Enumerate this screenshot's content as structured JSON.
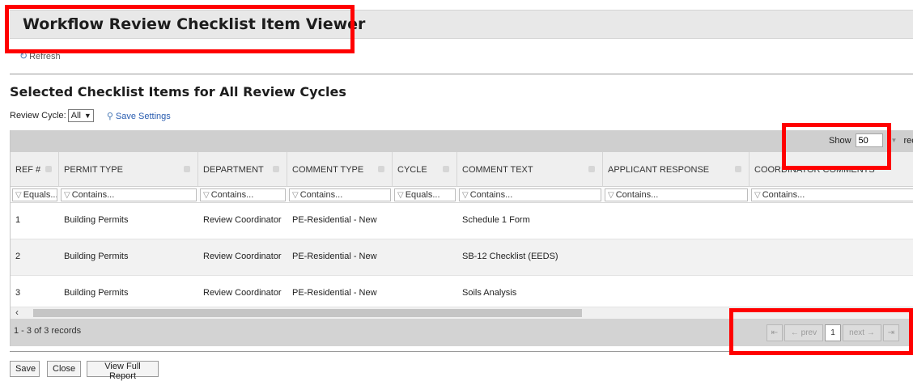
{
  "window": {
    "title": "Workflow Review Checklist Item Viewer"
  },
  "toolbar": {
    "refresh_label": "Refresh"
  },
  "section": {
    "title": "Selected Checklist Items for All Review Cycles"
  },
  "review_cycle": {
    "label": "Review Cycle:",
    "selected": "All",
    "save_settings_label": "Save Settings"
  },
  "grid": {
    "show_label": "Show",
    "page_size": "50",
    "records_label": "records",
    "columns": [
      "REF #",
      "PERMIT TYPE",
      "DEPARTMENT",
      "COMMENT TYPE",
      "CYCLE",
      "COMMENT TEXT",
      "APPLICANT RESPONSE",
      "COORDINATOR COMMENTS"
    ],
    "filters": [
      "Equals...",
      "Contains...",
      "Contains...",
      "Contains...",
      "Equals...",
      "Contains...",
      "Contains...",
      "Contains..."
    ],
    "rows": [
      {
        "ref": "1",
        "permit_type": "Building Permits",
        "department": "Review Coordinator",
        "comment_type": "PE-Residential - New",
        "cycle": "",
        "comment_text": "Schedule 1 Form",
        "applicant_response": "",
        "coordinator_comments": ""
      },
      {
        "ref": "2",
        "permit_type": "Building Permits",
        "department": "Review Coordinator",
        "comment_type": "PE-Residential - New",
        "cycle": "",
        "comment_text": "SB-12 Checklist (EEDS)",
        "applicant_response": "",
        "coordinator_comments": ""
      },
      {
        "ref": "3",
        "permit_type": "Building Permits",
        "department": "Review Coordinator",
        "comment_type": "PE-Residential - New",
        "cycle": "",
        "comment_text": "Soils Analysis",
        "applicant_response": "",
        "coordinator_comments": ""
      }
    ],
    "record_count": "1 - 3 of 3 records",
    "pager": {
      "first": "⇤",
      "prev": "← prev",
      "current": "1",
      "next": "next →",
      "last": "⇥"
    }
  },
  "buttons": {
    "save": "Save",
    "close": "Close",
    "view_full_report": "View Full Report"
  },
  "icons": {
    "refresh": "refresh-icon",
    "save_settings": "save-settings-icon",
    "filter": "filter-icon",
    "sort": "sort-icon"
  },
  "colors": {
    "highlight": "#ff0000",
    "link": "#2a5db0",
    "toolbar_bg": "#cfcfcf"
  }
}
